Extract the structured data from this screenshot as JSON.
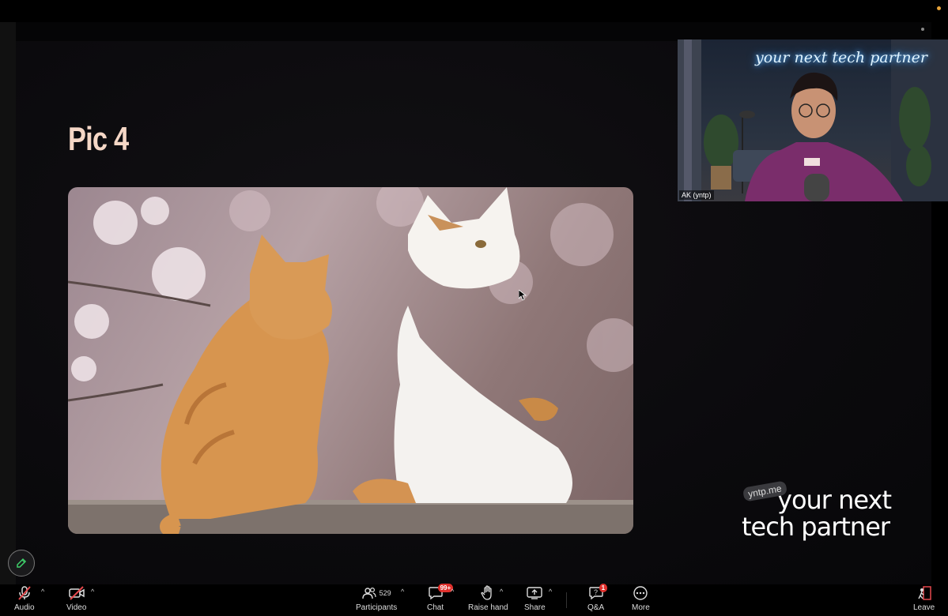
{
  "slide": {
    "title": "Pic 4"
  },
  "speaker": {
    "name": "AK (yntp)",
    "neon_sign": "your next tech partner"
  },
  "watermark": {
    "badge": "yntp.me",
    "line1": "your next",
    "line2": "tech partner"
  },
  "toolbar": {
    "audio_label": "Audio",
    "video_label": "Video",
    "participants_label": "Participants",
    "participants_count": "529",
    "chat_label": "Chat",
    "chat_badge": "99+",
    "raise_hand_label": "Raise hand",
    "share_label": "Share",
    "qa_label": "Q&A",
    "qa_badge": "1",
    "more_label": "More",
    "leave_label": "Leave"
  },
  "colors": {
    "badge_red": "#e0302c",
    "title_peach": "#f5d7c6",
    "muted_red": "#e5484d"
  }
}
